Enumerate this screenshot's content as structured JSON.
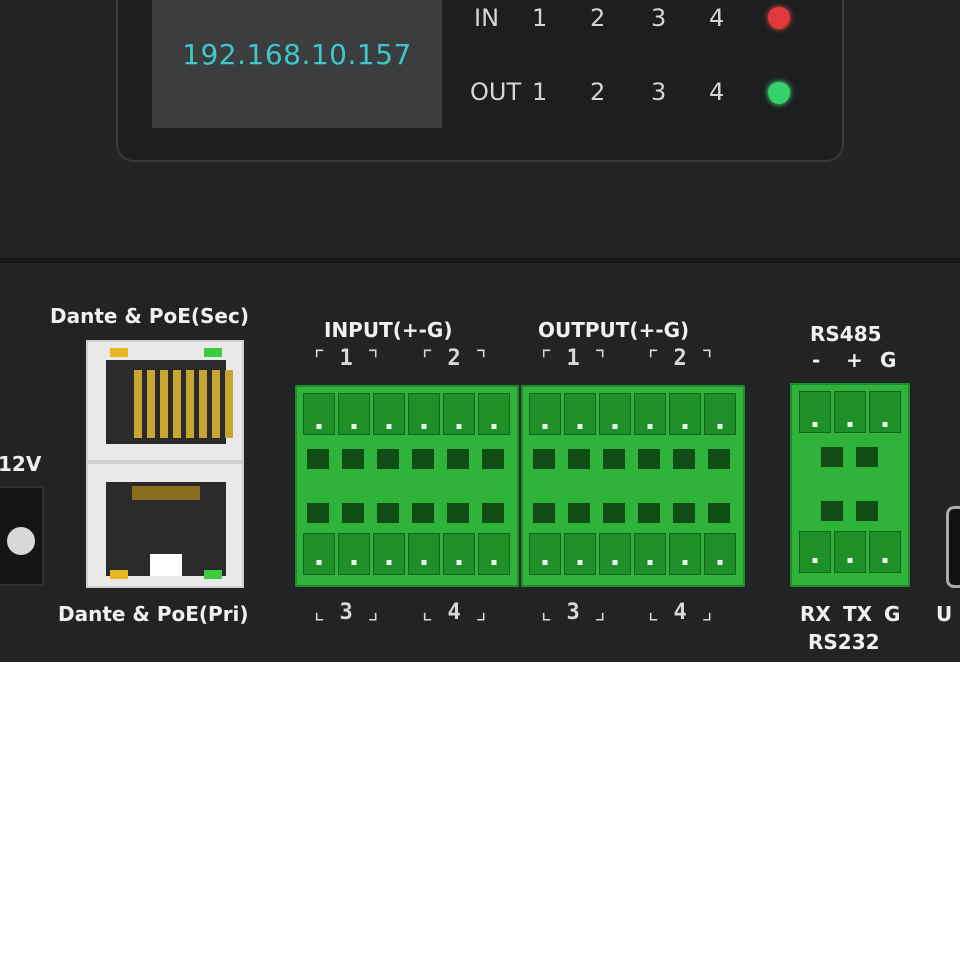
{
  "display": {
    "ip_address": "192.168.10.157",
    "in_label": "IN",
    "out_label": "OUT",
    "channel_numbers": [
      "1",
      "2",
      "3",
      "4"
    ]
  },
  "ports": {
    "power_label": "12V",
    "dante_secondary_label": "Dante & PoE(Sec)",
    "dante_primary_label": "Dante & PoE(Pri)",
    "input_label": "INPUT(+-G)",
    "output_label": "OUTPUT(+-G)",
    "group_top": [
      "1",
      "2"
    ],
    "group_bottom": [
      "3",
      "4"
    ],
    "rs485_label": "RS485",
    "rs485_pins": [
      "-",
      "+",
      "G"
    ],
    "rs232_pins": [
      "RX",
      "TX",
      "G"
    ],
    "rs232_label": "RS232",
    "usb_label": "U"
  },
  "indicators": {
    "in_led": "red",
    "out_led": "green"
  },
  "colors": {
    "ip_text": "#3fc8c7",
    "terminal_green": "#2fb33a",
    "led_red": "#e0393b",
    "led_green": "#33d26b",
    "device_body": "#222324"
  }
}
